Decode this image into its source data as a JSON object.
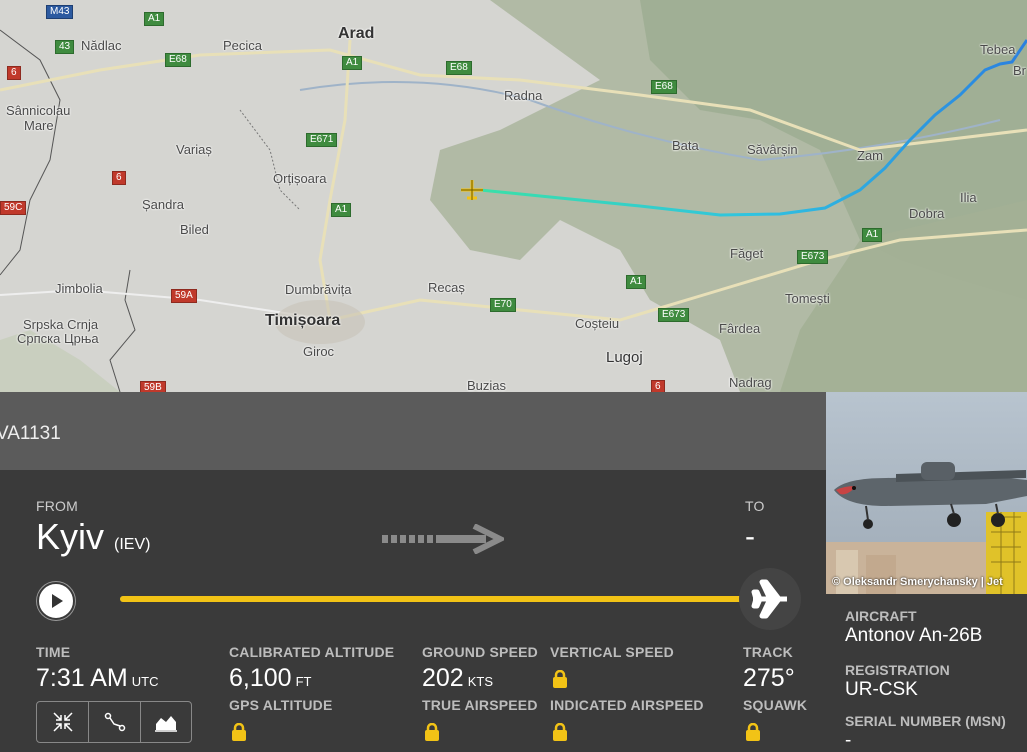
{
  "map": {
    "places": [
      {
        "name": "Nădlac"
      },
      {
        "name": "Pecica"
      },
      {
        "name": "Arad"
      },
      {
        "name": "Sânnicolau"
      },
      {
        "name": "Mare"
      },
      {
        "name": "Variaș"
      },
      {
        "name": "Orțișoara"
      },
      {
        "name": "Radna"
      },
      {
        "name": "Bata"
      },
      {
        "name": "Săvârșin"
      },
      {
        "name": "Zam"
      },
      {
        "name": "Tebea"
      },
      {
        "name": "Br"
      },
      {
        "name": "Ilia"
      },
      {
        "name": "Dobra"
      },
      {
        "name": "Șandra"
      },
      {
        "name": "Biled"
      },
      {
        "name": "Făget"
      },
      {
        "name": "Jimbolia"
      },
      {
        "name": "Dumbrăvița"
      },
      {
        "name": "Recaș"
      },
      {
        "name": "Timișoara"
      },
      {
        "name": "Tomești"
      },
      {
        "name": "Srpska Crnja"
      },
      {
        "name": "Српска Црња"
      },
      {
        "name": "Giroc"
      },
      {
        "name": "Coșteiu"
      },
      {
        "name": "Fârdea"
      },
      {
        "name": "Lugoj"
      },
      {
        "name": "Buzias"
      },
      {
        "name": "Nadrag"
      }
    ],
    "roads": [
      "M43",
      "A1",
      "43",
      "E68",
      "6",
      "A1",
      "E68",
      "E68",
      "E671",
      "6",
      "59C",
      "A1",
      "A1",
      "E673",
      "59A",
      "E70",
      "A1",
      "E673",
      "59B",
      "6"
    ]
  },
  "flight": {
    "callsign": "VA1131",
    "from_label": "FROM",
    "from_city": "Kyiv",
    "from_code": "(IEV)",
    "to_label": "TO",
    "to_city": "-",
    "progress": 1.0
  },
  "stats": {
    "time_label": "TIME",
    "time_value": "7:31 AM",
    "time_unit": "UTC",
    "cal_alt_label": "CALIBRATED ALTITUDE",
    "cal_alt_value": "6,100",
    "cal_alt_unit": "FT",
    "gps_alt_label": "GPS ALTITUDE",
    "ground_speed_label": "GROUND SPEED",
    "ground_speed_value": "202",
    "ground_speed_unit": "KTS",
    "true_airspeed_label": "TRUE AIRSPEED",
    "vertical_speed_label": "VERTICAL SPEED",
    "indicated_airspeed_label": "INDICATED AIRSPEED",
    "track_label": "TRACK",
    "track_value": "275°",
    "squawk_label": "SQUAWK"
  },
  "aircraft": {
    "photo_credit": "© Oleksandr Smerychansky | Jet",
    "aircraft_label": "AIRCRAFT",
    "aircraft_value": "Antonov An-26B",
    "registration_label": "REGISTRATION",
    "registration_value": "UR-CSK",
    "msn_label": "SERIAL NUMBER (MSN)",
    "msn_value": "-"
  },
  "colors": {
    "accent": "#f2c316",
    "panel": "#3a3a3a",
    "callbar": "#5b5b5b",
    "track_start": "#3ae0a8",
    "track_end": "#2a7fe0"
  }
}
